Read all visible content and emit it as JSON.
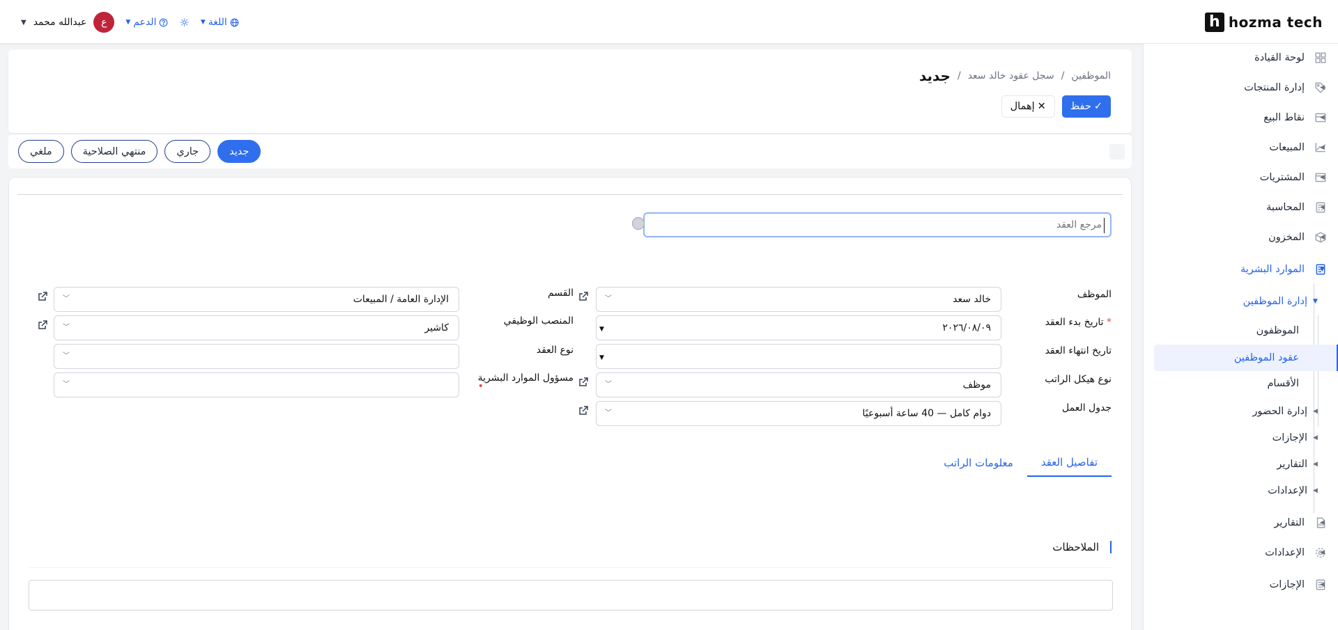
{
  "brand": {
    "name": "hozma tech",
    "mark": "h"
  },
  "topbar": {
    "user_name": "عبدالله محمد",
    "avatar_initial": "ع",
    "support_label": "الدعم",
    "language_label": "اللغة"
  },
  "sidebar": {
    "items": [
      {
        "label": "لوحة القيادة",
        "icon": "dashboard-icon"
      },
      {
        "label": "إدارة المنتجات",
        "icon": "tag-icon"
      },
      {
        "label": "نقاط البيع",
        "icon": "store-icon"
      },
      {
        "label": "المبيعات",
        "icon": "chart-line-icon"
      },
      {
        "label": "المشتريات",
        "icon": "box-icon"
      },
      {
        "label": "المحاسبة",
        "icon": "calculator-icon"
      },
      {
        "label": "المخزون",
        "icon": "cube-icon"
      },
      {
        "label": "الموارد البشرية",
        "icon": "document-icon"
      },
      {
        "label": "التقارير",
        "icon": "report-icon"
      },
      {
        "label": "الإعدادات",
        "icon": "gear-icon"
      },
      {
        "label": "الإجازات",
        "icon": "leave-icon"
      }
    ],
    "hr_sub": {
      "employees_mgmt": "إدارة الموظفين",
      "employees": "الموظفون",
      "contracts": "عقود الموظفين",
      "departments": "الأقسام",
      "attendance": "إدارة الحضور",
      "leaves": "الإجازات",
      "reports": "التقارير",
      "settings": "الإعدادات"
    }
  },
  "breadcrumb": {
    "level1": "الموظفين",
    "level2": "سجل عقود خالد سعد",
    "current": "جديد"
  },
  "actions": {
    "save": "حفظ",
    "discard": "إهمال"
  },
  "status": {
    "items": [
      "جديد",
      "جاري",
      "منتهي الصلاحية",
      "ملغي"
    ],
    "active": "جديد"
  },
  "form": {
    "reference_placeholder": "مرجع العقد",
    "fields": {
      "employee": {
        "label": "الموظف",
        "value": "خالد سعد"
      },
      "start_date": {
        "label": "تاريخ بدء العقد",
        "value": "٢٠٢٦/٠٨/٠٩"
      },
      "end_date": {
        "label": "تاريخ انتهاء العقد",
        "value": ""
      },
      "salary_structure": {
        "label": "نوع هيكل الراتب",
        "value": "موظف"
      },
      "work_schedule": {
        "label": "جدول العمل",
        "value": "دوام كامل — 40 ساعة أسبوعيًا"
      },
      "department": {
        "label": "القسم",
        "value": "الإدارة العامة / المبيعات"
      },
      "job_position": {
        "label": "المنصب الوظيفي",
        "value": "كاشير"
      },
      "contract_type": {
        "label": "نوع العقد",
        "value": ""
      },
      "hr_responsible": {
        "label": "مسؤول الموارد البشرية",
        "value": ""
      }
    },
    "tabs": [
      "تفاصيل العقد",
      "معلومات الراتب"
    ],
    "active_tab": "تفاصيل العقد",
    "notes_label": "الملاحظات"
  },
  "colors": {
    "primary": "#2f6fed",
    "avatar": "#c0243a",
    "required": "#ef4444"
  }
}
